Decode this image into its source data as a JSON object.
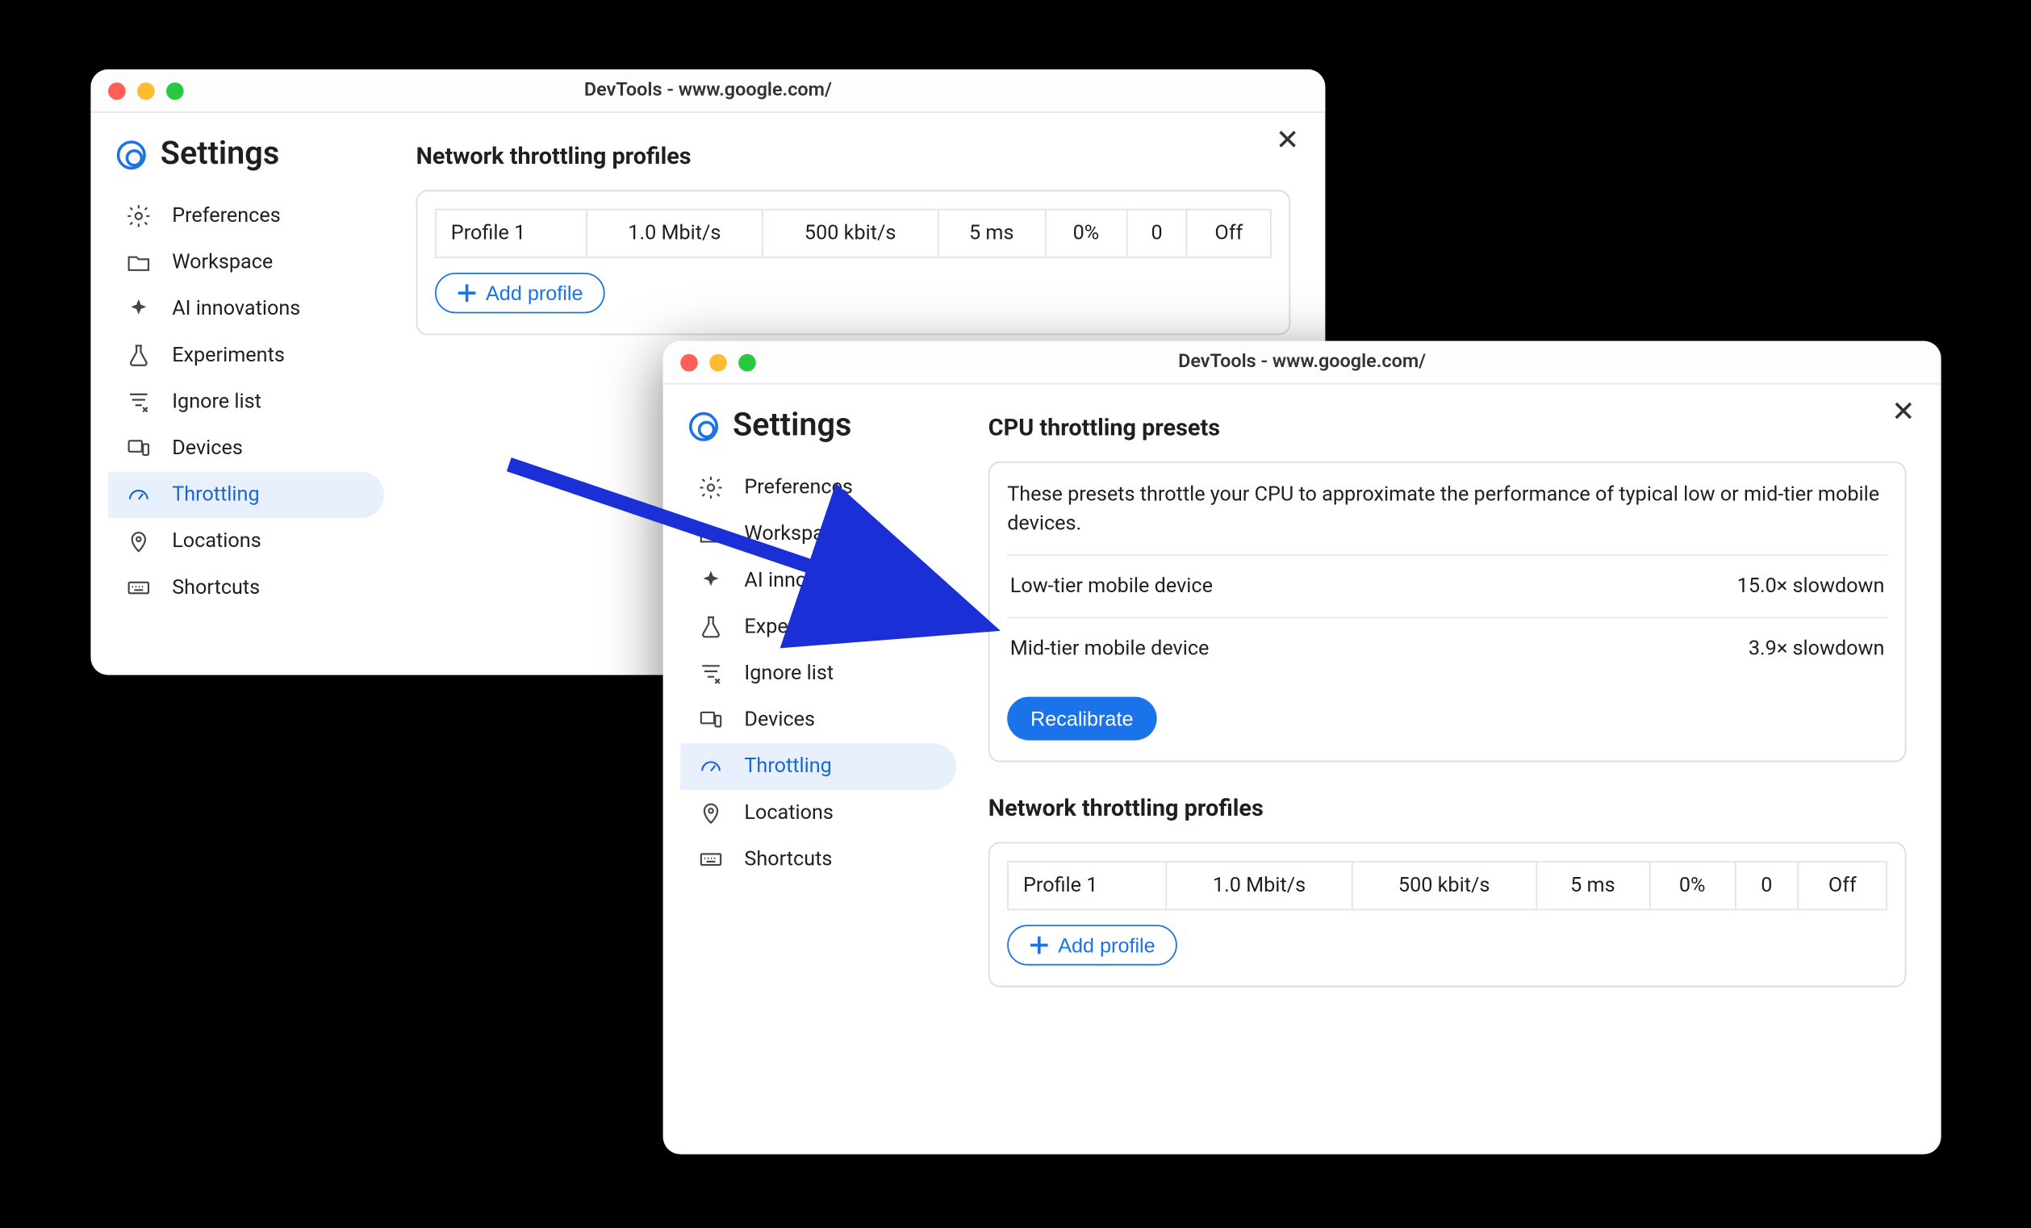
{
  "window_back": {
    "title": "DevTools - www.google.com/",
    "settings_title": "Settings",
    "nav": [
      {
        "label": "Preferences"
      },
      {
        "label": "Workspace"
      },
      {
        "label": "AI innovations"
      },
      {
        "label": "Experiments"
      },
      {
        "label": "Ignore list"
      },
      {
        "label": "Devices"
      },
      {
        "label": "Throttling"
      },
      {
        "label": "Locations"
      },
      {
        "label": "Shortcuts"
      }
    ],
    "section_title": "Network throttling profiles",
    "profile_row": {
      "name": "Profile 1",
      "down": "1.0 Mbit/s",
      "up": "500 kbit/s",
      "latency": "5 ms",
      "loss": "0%",
      "queue": "0",
      "reorder": "Off"
    },
    "add_profile_label": "Add profile"
  },
  "window_front": {
    "title": "DevTools - www.google.com/",
    "settings_title": "Settings",
    "nav": [
      {
        "label": "Preferences"
      },
      {
        "label": "Workspace"
      },
      {
        "label": "AI innovations"
      },
      {
        "label": "Experiments"
      },
      {
        "label": "Ignore list"
      },
      {
        "label": "Devices"
      },
      {
        "label": "Throttling"
      },
      {
        "label": "Locations"
      },
      {
        "label": "Shortcuts"
      }
    ],
    "cpu_section_title": "CPU throttling presets",
    "cpu_desc": "These presets throttle your CPU to approximate the performance of typical low or mid-tier mobile devices.",
    "preset_low": {
      "label": "Low-tier mobile device",
      "value": "15.0× slowdown"
    },
    "preset_mid": {
      "label": "Mid-tier mobile device",
      "value": "3.9× slowdown"
    },
    "recalibrate_label": "Recalibrate",
    "net_section_title": "Network throttling profiles",
    "profile_row": {
      "name": "Profile 1",
      "down": "1.0 Mbit/s",
      "up": "500 kbit/s",
      "latency": "5 ms",
      "loss": "0%",
      "queue": "0",
      "reorder": "Off"
    },
    "add_profile_label": "Add profile"
  }
}
